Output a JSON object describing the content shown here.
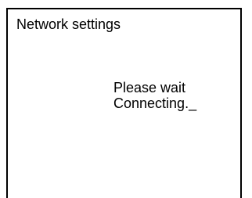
{
  "window": {
    "title": "Network settings"
  },
  "status": {
    "line1": "Please wait",
    "line2": "Connecting._"
  }
}
